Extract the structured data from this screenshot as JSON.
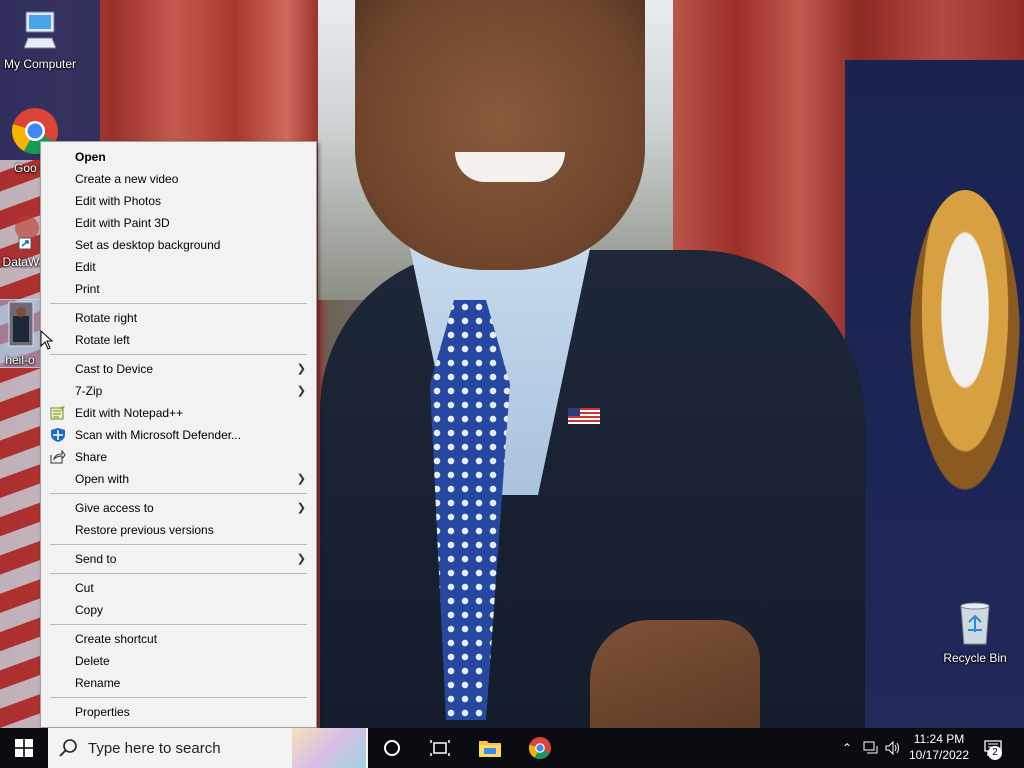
{
  "desktop": {
    "icons": [
      {
        "label": "My Computer",
        "icon": "monitor-icon"
      },
      {
        "label": "Goo Chro",
        "icon": "chrome-icon"
      },
      {
        "label": "DataWa",
        "icon": "datawrapper-icon"
      },
      {
        "label": "heil-o",
        "icon": "image-file-icon"
      },
      {
        "label": "Recycle Bin",
        "icon": "recycle-bin-icon"
      }
    ]
  },
  "context_menu": {
    "groups": [
      [
        {
          "label": "Open",
          "bold": true
        },
        {
          "label": "Create a new video"
        },
        {
          "label": "Edit with Photos"
        },
        {
          "label": "Edit with Paint 3D"
        },
        {
          "label": "Set as desktop background"
        },
        {
          "label": "Edit"
        },
        {
          "label": "Print"
        }
      ],
      [
        {
          "label": "Rotate right"
        },
        {
          "label": "Rotate left"
        }
      ],
      [
        {
          "label": "Cast to Device",
          "submenu": true
        },
        {
          "label": "7-Zip",
          "submenu": true
        },
        {
          "label": "Edit with Notepad++",
          "icon": "notepad-plus-plus-icon"
        },
        {
          "label": "Scan with Microsoft Defender...",
          "icon": "defender-shield-icon"
        },
        {
          "label": "Share",
          "icon": "share-icon"
        },
        {
          "label": "Open with",
          "submenu": true
        }
      ],
      [
        {
          "label": "Give access to",
          "submenu": true
        },
        {
          "label": "Restore previous versions"
        }
      ],
      [
        {
          "label": "Send to",
          "submenu": true
        }
      ],
      [
        {
          "label": "Cut"
        },
        {
          "label": "Copy"
        }
      ],
      [
        {
          "label": "Create shortcut"
        },
        {
          "label": "Delete"
        },
        {
          "label": "Rename"
        }
      ],
      [
        {
          "label": "Properties"
        }
      ]
    ]
  },
  "taskbar": {
    "search_placeholder": "Type here to search",
    "clock_time": "11:24 PM",
    "clock_date": "10/17/2022",
    "notification_count": "2"
  }
}
